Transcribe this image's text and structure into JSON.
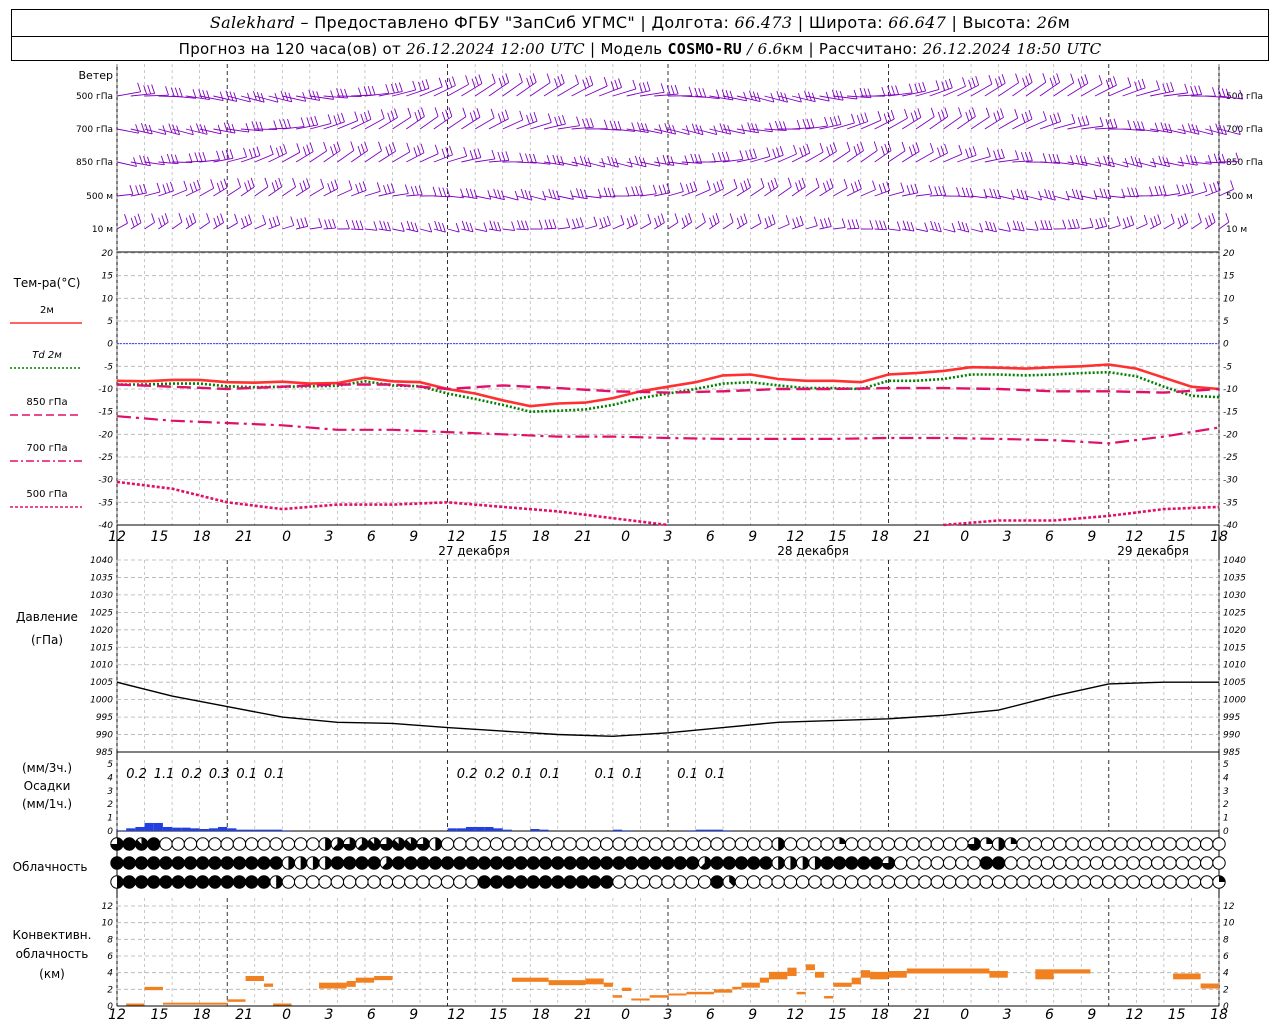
{
  "header": {
    "station": "Salekhard",
    "provider": "– Предоставлено ФГБУ \"ЗапСиб УГМС\"",
    "lon_label": "Долгота:",
    "lon_value": "66.473",
    "lat_label": "Широта:",
    "lat_value": "66.647",
    "alt_label": "Высота:",
    "alt_value": "26",
    "alt_unit": "м",
    "forecast_label": "Прогноз на 120 часа(ов) от",
    "forecast_start": "26.12.2024 12:00 UTC",
    "model_label": "Модель",
    "model_name": "COSMO-RU",
    "model_res": "/ 6.6",
    "model_res_unit": "км",
    "calc_label": "Рассчитано:",
    "calc_time": "26.12.2024 18:50 UTC"
  },
  "wind_panel": {
    "title": "Ветер",
    "levels": [
      "500 гПа",
      "700 гПа",
      "850 гПа",
      "500 м",
      "10 м"
    ],
    "right_levels": [
      "500 гПа",
      "700 гПа",
      "850 гПа",
      "500 м",
      "10 м"
    ]
  },
  "time_axis": {
    "hour_labels": [
      "12",
      "15",
      "18",
      "21",
      "0",
      "3",
      "6",
      "9",
      "12",
      "15",
      "18",
      "21",
      "0",
      "3",
      "6",
      "9",
      "12",
      "15",
      "18",
      "21",
      "0",
      "3",
      "6",
      "9",
      "12",
      "15",
      "18"
    ],
    "day_labels": [
      "27 декабря",
      "28 декабря",
      "29 декабря"
    ]
  },
  "temp_panel": {
    "title": "Тем-ра(°С)",
    "legend": [
      {
        "label": "2м",
        "color": "#ff3030",
        "dash": "solid"
      },
      {
        "label": "Td  2м",
        "color": "#008000",
        "dash": "dotted"
      },
      {
        "label": "850 гПа",
        "color": "#e0106a",
        "dash": "dashed"
      },
      {
        "label": "700 гПа",
        "color": "#e0106a",
        "dash": "dashdot"
      },
      {
        "label": "500 гПа",
        "color": "#e0106a",
        "dash": "fine"
      }
    ],
    "ticks": [
      20,
      15,
      10,
      5,
      0,
      -5,
      -10,
      -15,
      -20,
      -25,
      -30,
      -35,
      -40
    ]
  },
  "pressure_panel": {
    "title": "Давление",
    "unit": "(гПа)",
    "ticks": [
      1040,
      1035,
      1030,
      1025,
      1020,
      1015,
      1010,
      1005,
      1000,
      995,
      990,
      985
    ]
  },
  "precip_panel": {
    "unit3h": "(мм/3ч.)",
    "title": "Осадки",
    "unit1h": "(мм/1ч.)",
    "ticks": [
      "5",
      "4",
      "3",
      "2",
      "1",
      "0"
    ],
    "labels": [
      {
        "h": 3,
        "text": "0.2"
      },
      {
        "h": 6,
        "text": "1.1"
      },
      {
        "h": 9,
        "text": "0.2"
      },
      {
        "h": 12,
        "text": "0.3"
      },
      {
        "h": 15,
        "text": "0.1"
      },
      {
        "h": 18,
        "text": "0.1"
      },
      {
        "h": 39,
        "text": "0.2"
      },
      {
        "h": 42,
        "text": "0.2"
      },
      {
        "h": 45,
        "text": "0.1"
      },
      {
        "h": 48,
        "text": "0.1"
      },
      {
        "h": 54,
        "text": "0.1"
      },
      {
        "h": 57,
        "text": "0.1"
      },
      {
        "h": 63,
        "text": "0.1"
      },
      {
        "h": 66,
        "text": "0.1"
      }
    ]
  },
  "cloud_panel": {
    "title": "Облачность"
  },
  "conv_panel": {
    "title1": "Конвективн.",
    "title2": "облачность",
    "unit": "(км)",
    "ticks": [
      "12",
      "10",
      "8",
      "6",
      "4",
      "2",
      "0"
    ]
  },
  "colors": {
    "wind": "#8000c0",
    "temp2m": "#ff3030",
    "dew": "#008000",
    "upper": "#e0106a",
    "pressure": "#000000",
    "precip": "#2040e0",
    "conv": "#f08020",
    "zero_line": "#4040ff"
  },
  "chart_data": [
    {
      "type": "line",
      "title": "Тем-ра(°С)",
      "x_unit": "hours from 26.12.2024 12:00 UTC",
      "ylim": [
        -40,
        20
      ],
      "grid": true,
      "series": [
        {
          "name": "2м",
          "x": [
            0,
            3,
            6,
            9,
            12,
            15,
            18,
            21,
            24,
            27,
            30,
            33,
            36,
            39,
            42,
            45,
            48,
            51,
            54,
            57,
            60,
            63,
            66,
            69,
            72,
            75,
            78,
            81,
            84,
            87,
            90,
            93,
            96,
            99,
            102,
            105,
            108,
            111,
            114,
            117,
            120
          ],
          "values": [
            -8.2,
            -8.3,
            -8.0,
            -8.0,
            -8.5,
            -8.6,
            -8.4,
            -8.8,
            -8.7,
            -7.5,
            -8.3,
            -8.5,
            -10,
            -11,
            -12.5,
            -13.8,
            -13.2,
            -13,
            -12,
            -10.5,
            -9.5,
            -8.5,
            -7,
            -6.8,
            -7.8,
            -8.2,
            -8.2,
            -8.5,
            -6.8,
            -6.5,
            -6.0,
            -5.2,
            -5.3,
            -5.5,
            -5.2,
            -5.0,
            -4.6,
            -5.5,
            -7.5,
            -9.5,
            -10
          ]
        },
        {
          "name": "Td 2м",
          "x": [
            0,
            3,
            6,
            9,
            12,
            15,
            18,
            21,
            24,
            27,
            30,
            33,
            36,
            39,
            42,
            45,
            48,
            51,
            54,
            57,
            60,
            63,
            66,
            69,
            72,
            75,
            78,
            81,
            84,
            87,
            90,
            93,
            96,
            99,
            102,
            105,
            108,
            111,
            114,
            117,
            120
          ],
          "values": [
            -9,
            -9,
            -8.8,
            -8.8,
            -9.4,
            -9.6,
            -9.5,
            -9.4,
            -9.3,
            -8.3,
            -9.2,
            -9.4,
            -11,
            -12.2,
            -13.5,
            -15.0,
            -14.8,
            -14.5,
            -13.5,
            -12,
            -11,
            -10,
            -8.8,
            -8.5,
            -9.2,
            -9.8,
            -9.8,
            -10,
            -8.2,
            -8.2,
            -7.8,
            -6.8,
            -6.8,
            -7,
            -6.8,
            -6.5,
            -6.3,
            -7.2,
            -9.5,
            -11.5,
            -11.8
          ]
        },
        {
          "name": "850 гПа",
          "x": [
            0,
            6,
            12,
            18,
            24,
            30,
            36,
            42,
            48,
            54,
            60,
            66,
            72,
            78,
            84,
            90,
            96,
            102,
            108,
            114,
            120
          ],
          "values": [
            -9,
            -9.5,
            -10,
            -9.5,
            -9,
            -9,
            -10,
            -9.2,
            -9.8,
            -10.5,
            -10.8,
            -10.5,
            -10,
            -10,
            -9.8,
            -9.8,
            -10,
            -10.5,
            -10.5,
            -10.8,
            -10
          ]
        },
        {
          "name": "700 гПа",
          "x": [
            0,
            6,
            12,
            18,
            24,
            30,
            36,
            42,
            48,
            54,
            60,
            66,
            72,
            78,
            84,
            90,
            96,
            102,
            108,
            114,
            120
          ],
          "values": [
            -16,
            -17,
            -17.5,
            -18,
            -19,
            -19,
            -19.5,
            -20,
            -20.5,
            -20.5,
            -20.8,
            -21,
            -21,
            -21,
            -20.8,
            -20.8,
            -21,
            -21.3,
            -22,
            -20.5,
            -18.5
          ]
        },
        {
          "name": "500 гПа",
          "x": [
            0,
            6,
            12,
            18,
            24,
            30,
            36,
            42,
            48,
            54,
            60,
            66,
            72,
            78,
            84,
            90,
            96,
            102,
            108,
            114,
            120
          ],
          "values": [
            -30.5,
            -32,
            -35,
            -36.5,
            -35.5,
            -35.5,
            -35,
            -36,
            -37,
            -38.5,
            -40,
            -42,
            -43,
            -43,
            -42,
            -40,
            -39,
            -39,
            -38,
            -36.5,
            -36
          ]
        }
      ]
    },
    {
      "type": "line",
      "title": "Давление",
      "x_unit": "hours from 26.12.2024 12:00 UTC",
      "ylim": [
        985,
        1040
      ],
      "grid": true,
      "series": [
        {
          "name": "",
          "x": [
            0,
            6,
            12,
            18,
            24,
            30,
            36,
            42,
            48,
            54,
            60,
            66,
            72,
            78,
            84,
            90,
            96,
            102,
            108,
            114,
            120
          ],
          "values": [
            1005,
            1001,
            998,
            995,
            993.5,
            993.2,
            992,
            991,
            990,
            989.5,
            990.5,
            992,
            993.5,
            994,
            994.5,
            995.5,
            997,
            1001,
            1004.5,
            1005,
            1005
          ]
        }
      ]
    },
    {
      "type": "bar",
      "title": "Осадки",
      "unit": "мм/1ч.",
      "ylim": [
        0,
        5
      ],
      "x": [
        0,
        1,
        2,
        3,
        4,
        5,
        6,
        7,
        8,
        9,
        10,
        11,
        12,
        13,
        14,
        15,
        16,
        17,
        18,
        36,
        37,
        38,
        39,
        40,
        41,
        42,
        45,
        46,
        54,
        55,
        62,
        63,
        64,
        65,
        66
      ],
      "values": [
        0.05,
        0.2,
        0.3,
        0.6,
        0.6,
        0.3,
        0.25,
        0.25,
        0.2,
        0.15,
        0.2,
        0.3,
        0.2,
        0.1,
        0.1,
        0.1,
        0.1,
        0.1,
        0.05,
        0.2,
        0.2,
        0.3,
        0.3,
        0.3,
        0.2,
        0.1,
        0.15,
        0.1,
        0.1,
        0.05,
        0.05,
        0.1,
        0.1,
        0.1,
        0.05
      ]
    },
    {
      "type": "table",
      "title": "Облачность",
      "rows": 3,
      "cols": 40,
      "cover_eighths": [
        [
          6,
          8,
          7,
          8,
          0,
          0,
          0,
          0,
          0,
          0,
          0,
          0,
          0,
          0,
          0,
          0,
          0,
          4,
          5,
          6,
          5,
          7,
          6,
          7,
          7,
          6,
          4,
          0,
          0,
          0,
          0,
          0,
          0,
          0,
          0,
          0,
          0,
          0,
          0,
          0,
          0,
          0,
          0,
          0,
          0,
          0,
          0,
          0,
          0,
          0,
          0,
          0,
          0,
          0,
          4,
          0,
          0,
          0,
          0,
          2,
          0,
          0,
          0,
          0,
          0,
          0,
          0,
          0,
          0,
          0,
          6,
          2,
          4,
          2,
          0,
          0,
          0,
          0,
          0,
          0,
          0,
          0,
          0,
          0,
          0,
          0,
          0,
          0,
          0,
          0,
          0
        ],
        [
          8,
          8,
          8,
          8,
          8,
          8,
          8,
          8,
          8,
          8,
          8,
          8,
          8,
          8,
          4,
          4,
          4,
          4,
          8,
          8,
          8,
          8,
          5,
          8,
          8,
          8,
          8,
          8,
          8,
          8,
          8,
          8,
          8,
          8,
          8,
          8,
          8,
          8,
          8,
          8,
          8,
          8,
          8,
          8,
          8,
          8,
          8,
          8,
          5,
          8,
          8,
          8,
          8,
          8,
          4,
          4,
          4,
          4,
          8,
          8,
          8,
          8,
          8,
          6,
          0,
          0,
          0,
          0,
          0,
          0,
          0,
          8,
          8,
          0,
          0,
          0,
          0,
          0,
          0,
          0,
          0,
          0,
          0,
          0,
          0,
          0,
          0,
          0,
          0,
          0,
          0
        ],
        [
          4,
          8,
          8,
          8,
          8,
          8,
          8,
          8,
          8,
          8,
          8,
          8,
          8,
          4,
          0,
          0,
          0,
          0,
          0,
          0,
          0,
          0,
          0,
          0,
          0,
          0,
          0,
          0,
          0,
          0,
          8,
          8,
          8,
          8,
          8,
          8,
          8,
          8,
          8,
          8,
          8,
          0,
          0,
          0,
          0,
          0,
          0,
          0,
          0,
          8,
          3,
          0,
          0,
          0,
          0,
          0,
          0,
          0,
          0,
          0,
          0,
          0,
          0,
          0,
          0,
          0,
          0,
          0,
          0,
          0,
          0,
          0,
          0,
          0,
          0,
          0,
          0,
          0,
          0,
          0,
          0,
          0,
          0,
          0,
          0,
          0,
          0,
          0,
          0,
          0,
          2
        ]
      ]
    },
    {
      "type": "bar",
      "title": "Конвективн. облачность",
      "unit": "км",
      "ylim": [
        0,
        12
      ],
      "segments": [
        {
          "x0": 1,
          "x1": 3,
          "base": 0.1,
          "top": 0.3
        },
        {
          "x0": 3,
          "x1": 5,
          "base": 1.9,
          "top": 2.3
        },
        {
          "x0": 5,
          "x1": 12,
          "base": 0.2,
          "top": 0.4
        },
        {
          "x0": 12,
          "x1": 14,
          "base": 0.5,
          "top": 0.8
        },
        {
          "x0": 14,
          "x1": 16,
          "base": 3.0,
          "top": 3.6
        },
        {
          "x0": 16,
          "x1": 17,
          "base": 2.3,
          "top": 2.7
        },
        {
          "x0": 17,
          "x1": 19,
          "base": 0.1,
          "top": 0.3
        },
        {
          "x0": 22,
          "x1": 25,
          "base": 2.1,
          "top": 2.8
        },
        {
          "x0": 25,
          "x1": 26,
          "base": 2.3,
          "top": 3.0
        },
        {
          "x0": 26,
          "x1": 28,
          "base": 2.8,
          "top": 3.4
        },
        {
          "x0": 28,
          "x1": 30,
          "base": 3.1,
          "top": 3.6
        },
        {
          "x0": 43,
          "x1": 47,
          "base": 2.9,
          "top": 3.4
        },
        {
          "x0": 47,
          "x1": 51,
          "base": 2.5,
          "top": 3.1
        },
        {
          "x0": 51,
          "x1": 53,
          "base": 2.6,
          "top": 3.3
        },
        {
          "x0": 53,
          "x1": 54,
          "base": 2.3,
          "top": 2.8
        },
        {
          "x0": 54,
          "x1": 55,
          "base": 1.0,
          "top": 1.3
        },
        {
          "x0": 55,
          "x1": 56,
          "base": 1.8,
          "top": 2.2
        },
        {
          "x0": 56,
          "x1": 58,
          "base": 0.7,
          "top": 0.9
        },
        {
          "x0": 58,
          "x1": 60,
          "base": 1.0,
          "top": 1.3
        },
        {
          "x0": 60,
          "x1": 62,
          "base": 1.3,
          "top": 1.5
        },
        {
          "x0": 62,
          "x1": 65,
          "base": 1.4,
          "top": 1.7
        },
        {
          "x0": 65,
          "x1": 67,
          "base": 1.6,
          "top": 2.0
        },
        {
          "x0": 67,
          "x1": 68,
          "base": 2.0,
          "top": 2.3
        },
        {
          "x0": 68,
          "x1": 70,
          "base": 2.2,
          "top": 2.8
        },
        {
          "x0": 70,
          "x1": 71,
          "base": 2.8,
          "top": 3.4
        },
        {
          "x0": 71,
          "x1": 73,
          "base": 3.2,
          "top": 4.1
        },
        {
          "x0": 73,
          "x1": 74,
          "base": 3.6,
          "top": 4.6
        },
        {
          "x0": 74,
          "x1": 75,
          "base": 1.4,
          "top": 1.7
        },
        {
          "x0": 75,
          "x1": 76,
          "base": 4.3,
          "top": 5.0
        },
        {
          "x0": 76,
          "x1": 77,
          "base": 3.4,
          "top": 4.1
        },
        {
          "x0": 77,
          "x1": 78,
          "base": 0.9,
          "top": 1.2
        },
        {
          "x0": 78,
          "x1": 80,
          "base": 2.3,
          "top": 2.8
        },
        {
          "x0": 80,
          "x1": 81,
          "base": 2.6,
          "top": 3.4
        },
        {
          "x0": 81,
          "x1": 82,
          "base": 3.4,
          "top": 4.3
        },
        {
          "x0": 82,
          "x1": 84,
          "base": 3.2,
          "top": 4.1
        },
        {
          "x0": 84,
          "x1": 86,
          "base": 3.4,
          "top": 4.2
        },
        {
          "x0": 86,
          "x1": 95,
          "base": 3.9,
          "top": 4.5
        },
        {
          "x0": 95,
          "x1": 97,
          "base": 3.4,
          "top": 4.2
        },
        {
          "x0": 100,
          "x1": 102,
          "base": 3.2,
          "top": 4.4
        },
        {
          "x0": 102,
          "x1": 106,
          "base": 3.9,
          "top": 4.4
        },
        {
          "x0": 115,
          "x1": 118,
          "base": 3.2,
          "top": 3.9
        },
        {
          "x0": 118,
          "x1": 120,
          "base": 2.1,
          "top": 2.7
        }
      ]
    }
  ]
}
